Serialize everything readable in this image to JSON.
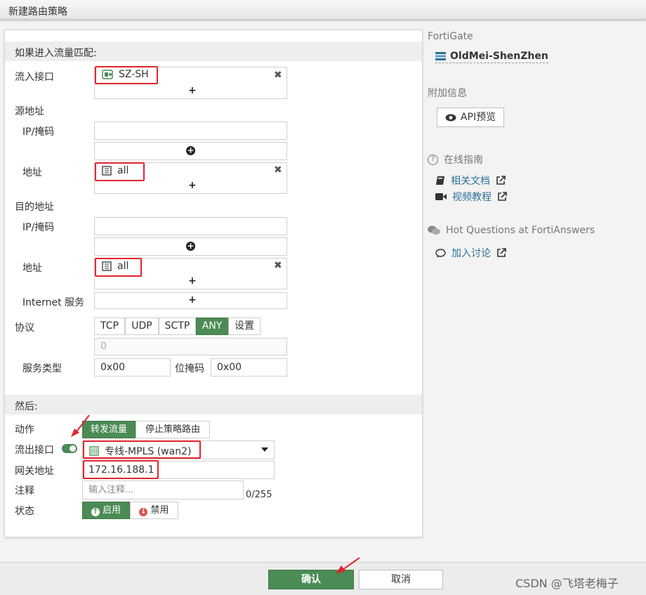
{
  "window": {
    "title": "新建路由策略"
  },
  "match": {
    "header": "如果进入流量匹配:",
    "incoming_interface_label": "流入接口",
    "incoming_interface_value": "SZ-SH",
    "source_label": "源地址",
    "ip_mask_label": "IP/掩码",
    "address_label": "地址",
    "source_address_value": "all",
    "destination_label": "目的地址",
    "destination_address_value": "all",
    "internet_service_label": "Internet 服务",
    "protocol_label": "协议",
    "protocol_options": [
      "TCP",
      "UDP",
      "SCTP",
      "ANY",
      "设置"
    ],
    "protocol_selected": "ANY",
    "protocol_number_value": "0",
    "service_type_label": "服务类型",
    "service_type_value": "0x00",
    "bitmask_label": "位掩码",
    "bitmask_value": "0x00",
    "add_symbol": "+"
  },
  "then": {
    "header": "然后:",
    "action_label": "动作",
    "action_options": [
      "转发流量",
      "停止策略路由"
    ],
    "action_selected": "转发流量",
    "outgoing_interface_label": "流出接口",
    "outgoing_interface_value": "专线-MPLS (wan2)",
    "gateway_label": "网关地址",
    "gateway_value": "172.16.188.1",
    "comment_label": "注释",
    "comment_placeholder": "输入注释...",
    "comment_counter": "0/255",
    "status_label": "状态",
    "status_enable": "启用",
    "status_disable": "禁用"
  },
  "sidebar": {
    "device_label": "FortiGate",
    "device_name": "OldMei-ShenZhen",
    "additional_info_label": "附加信息",
    "api_preview_button": "API预览",
    "online_guide_label": "在线指南",
    "related_docs_link": "相关文档",
    "video_tutorial_link": "视频教程",
    "hot_questions_label": "Hot Questions at FortiAnswers",
    "join_discussion_link": "加入讨论"
  },
  "footer": {
    "ok_button": "确认",
    "cancel_button": "取消",
    "watermark": "CSDN @飞塔老梅子"
  },
  "colors": {
    "accent_green": "#4b8b55",
    "annotation_red": "#e0262f",
    "link_blue": "#2d6f9a"
  }
}
